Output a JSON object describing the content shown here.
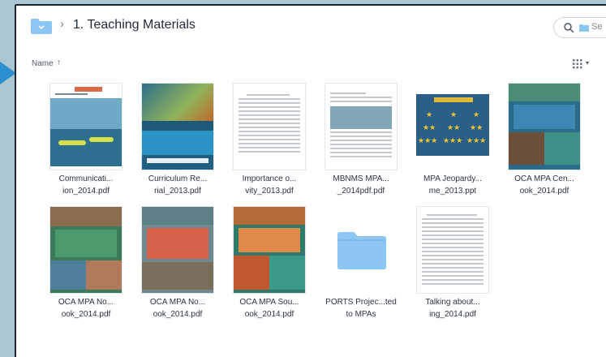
{
  "header": {
    "title": "1. Teaching Materials",
    "search_placeholder": "Se"
  },
  "sortbar": {
    "name_label": "Name",
    "sort_arrow": "↑"
  },
  "files": [
    {
      "line1": "Communicati...",
      "line2": "ion_2014.pdf"
    },
    {
      "line1": "Curriculum Re...",
      "line2": "rial_2013.pdf"
    },
    {
      "line1": "Importance o...",
      "line2": "vity_2013.pdf"
    },
    {
      "line1": "MBNMS MPA...",
      "line2": "_2014pdf.pdf"
    },
    {
      "line1": "MPA Jeopardy...",
      "line2": "me_2013.ppt"
    },
    {
      "line1": "OCA MPA Cen...",
      "line2": "ook_2014.pdf"
    },
    {
      "line1": "OCA MPA No...",
      "line2": "ook_2014.pdf"
    },
    {
      "line1": "OCA MPA No...",
      "line2": "ook_2014.pdf"
    },
    {
      "line1": "OCA MPA Sou...",
      "line2": "ook_2014.pdf"
    },
    {
      "line1": "PORTS Projec...ted",
      "line2": "to MPAs"
    },
    {
      "line1": "Talking about...",
      "line2": "ing_2014.pdf"
    }
  ],
  "colors": {
    "folder": "#8cc6f2",
    "folder_dark": "#6fb1e6",
    "accent_arrow": "#2b8fd0"
  }
}
